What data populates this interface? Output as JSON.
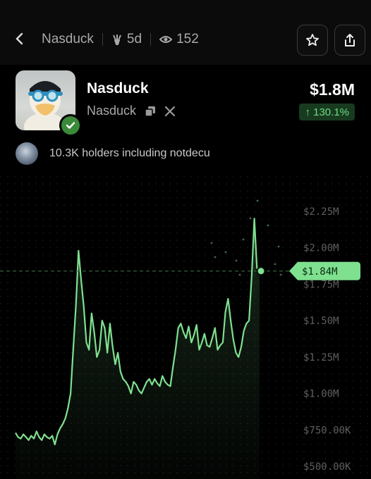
{
  "header": {
    "title": "Nasduck",
    "age": "5d",
    "views": "152"
  },
  "token": {
    "name": "Nasduck",
    "ticker": "Nasduck",
    "market_cap": "$1.8M",
    "change": "↑ 130.1%",
    "holders_text": "10.3K holders including notdecu"
  },
  "colors": {
    "accent": "#7fe08f",
    "badge": "#3a8a3a",
    "up": "#6fdc82"
  },
  "icons": [
    "back-arrow-icon",
    "claw-icon",
    "eye-icon",
    "star-icon",
    "share-icon",
    "copy-icon",
    "x-logo-icon",
    "verified-check-icon"
  ],
  "chart_data": {
    "type": "line",
    "y_ticks": [
      "$2.25M",
      "$2.00M",
      "$1.75M",
      "$1.50M",
      "$1.25M",
      "$1.00M",
      "$750.00K",
      "$500.00K"
    ],
    "ylim": [
      500000,
      2250000
    ],
    "current_value": 1840000,
    "current_label": "$1.84M",
    "grid": "dots",
    "series": [
      {
        "values": [
          730000,
          700000,
          690000,
          720000,
          700000,
          680000,
          710000,
          690000,
          740000,
          700000,
          680000,
          720000,
          700000,
          690000,
          710000,
          650000,
          720000,
          760000,
          790000,
          830000,
          900000,
          1000000,
          1300000,
          1600000,
          1980000,
          1780000,
          1600000,
          1350000,
          1300000,
          1550000,
          1420000,
          1250000,
          1300000,
          1500000,
          1450000,
          1280000,
          1480000,
          1320000,
          1200000,
          1280000,
          1150000,
          1100000,
          1080000,
          1050000,
          1000000,
          1080000,
          1060000,
          1020000,
          1000000,
          1040000,
          1080000,
          1100000,
          1060000,
          1100000,
          1070000,
          1050000,
          1120000,
          1080000,
          1060000,
          1050000,
          1180000,
          1300000,
          1450000,
          1480000,
          1420000,
          1380000,
          1460000,
          1350000,
          1400000,
          1470000,
          1300000,
          1350000,
          1410000,
          1330000,
          1320000,
          1380000,
          1450000,
          1300000,
          1330000,
          1350000,
          1560000,
          1650000,
          1500000,
          1370000,
          1280000,
          1250000,
          1320000,
          1430000,
          1480000,
          1500000,
          1800000,
          2200000,
          1860000,
          1840000
        ]
      }
    ]
  }
}
